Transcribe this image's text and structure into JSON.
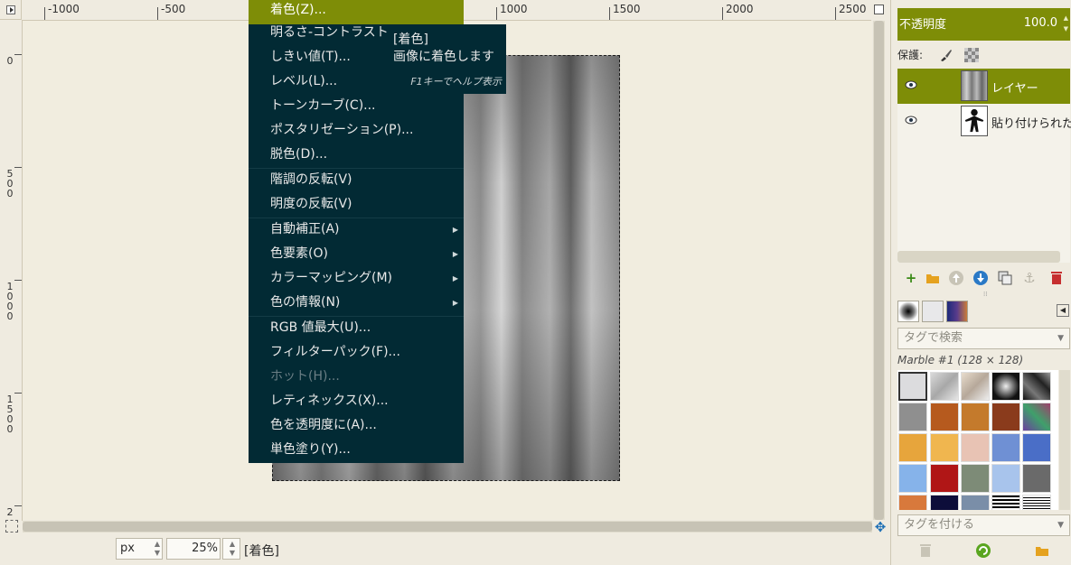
{
  "rulers": {
    "horizontal_labels": [
      "-1000",
      "-500",
      "1000",
      "1500",
      "2000",
      "2500"
    ],
    "vertical_labels": [
      "0",
      "500",
      "1000",
      "1500",
      "2"
    ]
  },
  "menu": {
    "items": [
      {
        "label": "着色(Z)...",
        "highlighted": true
      },
      {
        "label": "明るさ-コントラスト"
      },
      {
        "label": "しきい値(T)..."
      },
      {
        "label": "レベル(L)..."
      },
      {
        "label": "トーンカーブ(C)..."
      },
      {
        "label": "ポスタリゼーション(P)..."
      },
      {
        "label": "脱色(D)..."
      },
      {
        "label": "階調の反転(V)"
      },
      {
        "label": "明度の反転(V)"
      },
      {
        "label": "自動補正(A)",
        "submenu": true
      },
      {
        "label": "色要素(O)",
        "submenu": true
      },
      {
        "label": "カラーマッピング(M)",
        "submenu": true
      },
      {
        "label": "色の情報(N)",
        "submenu": true
      },
      {
        "label": "RGB 値最大(U)..."
      },
      {
        "label": "フィルターパック(F)..."
      },
      {
        "label": "ホット(H)...",
        "disabled": true
      },
      {
        "label": "レティネックス(X)..."
      },
      {
        "label": "色を透明度に(A)..."
      },
      {
        "label": "単色塗り(Y)..."
      }
    ]
  },
  "tooltip": {
    "title": "[着色]",
    "description": "画像に着色します",
    "help_hint": "F1キーでヘルプ表示"
  },
  "statusbar": {
    "unit": "px",
    "zoom": "25",
    "zoom_unit": "%",
    "message": "[着色]"
  },
  "layers_panel": {
    "opacity_label": "不透明度",
    "opacity_value": "100.0",
    "lock_label": "保護:",
    "layers": [
      {
        "name": "レイヤー",
        "selected": true,
        "visible": true
      },
      {
        "name": "貼り付けられた",
        "selected": false,
        "visible": true
      }
    ]
  },
  "patterns_panel": {
    "tag_search_placeholder": "タグで検索",
    "selected_pattern": "Marble #1 (128 × 128)",
    "tag_apply_placeholder": "タグを付ける"
  },
  "colors": {
    "menu_bg": "#022a34",
    "highlight": "#7e8d07",
    "canvas_bg": "#f1eddf"
  }
}
